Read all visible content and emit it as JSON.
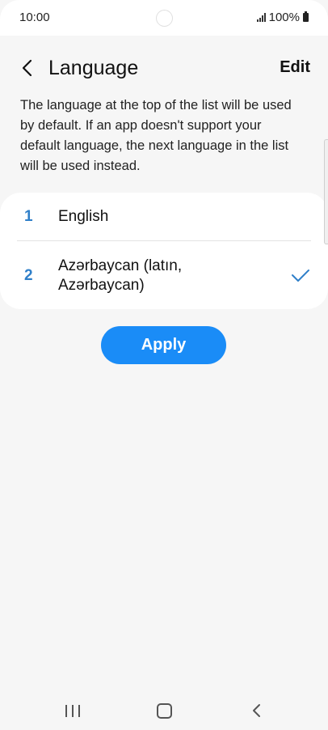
{
  "status_bar": {
    "time": "10:00",
    "battery_text": "100%"
  },
  "header": {
    "title": "Language",
    "edit_label": "Edit"
  },
  "description": "The language at the top of the list will be used by default. If an app doesn't support your default language, the next language in the list will be used instead.",
  "languages": [
    {
      "number": "1",
      "name": "English",
      "selected": false
    },
    {
      "number": "2",
      "name": "Azərbaycan (latın, Azərbaycan)",
      "selected": true
    }
  ],
  "apply_label": "Apply",
  "colors": {
    "accent": "#1a8cf7",
    "number": "#2f7fc9",
    "background": "#f6f6f6"
  },
  "icons": {
    "back": "chevron-left-icon",
    "check": "check-icon",
    "nav_recents": "recents-icon",
    "nav_home": "home-icon",
    "nav_back": "back-icon"
  }
}
